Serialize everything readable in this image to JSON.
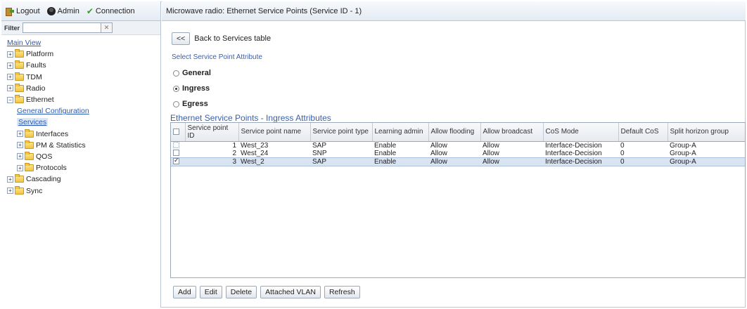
{
  "toolbar": {
    "logout": "Logout",
    "admin": "Admin",
    "connection": "Connection"
  },
  "filter": {
    "label": "Filter",
    "value": ""
  },
  "tree": {
    "main_view": "Main View",
    "platform": "Platform",
    "faults": "Faults",
    "tdm": "TDM",
    "radio": "Radio",
    "ethernet": "Ethernet",
    "general_configuration": "General Configuration",
    "services": "Services",
    "interfaces": "Interfaces",
    "pm_statistics": "PM & Statistics",
    "qos": "QOS",
    "protocols": "Protocols",
    "cascading": "Cascading",
    "sync": "Sync"
  },
  "main": {
    "title": "Microwave radio: Ethernet Service Points (Service ID - 1)",
    "back_button": "<<",
    "back_label": "Back to Services table",
    "select_attr_title": "Select Service Point Attribute",
    "radios": [
      {
        "label": "General",
        "checked": false
      },
      {
        "label": "Ingress",
        "checked": true
      },
      {
        "label": "Egress",
        "checked": false
      }
    ],
    "table_title": "Ethernet Service Points - Ingress Attributes",
    "columns": [
      "Service point ID",
      "Service point name",
      "Service point type",
      "Learning admin",
      "Allow flooding",
      "Allow broadcast",
      "CoS Mode",
      "Default CoS",
      "Split horizon group"
    ],
    "rows": [
      {
        "id": "1",
        "name": "West_23",
        "type": "SAP",
        "learning": "Enable",
        "flooding": "Allow",
        "broadcast": "Allow",
        "cos_mode": "Interface-Decision",
        "default_cos": "0",
        "split": "Group-A"
      },
      {
        "id": "2",
        "name": "West_24",
        "type": "SNP",
        "learning": "Enable",
        "flooding": "Allow",
        "broadcast": "Allow",
        "cos_mode": "Interface-Decision",
        "default_cos": "0",
        "split": "Group-A"
      },
      {
        "id": "3",
        "name": "West_2",
        "type": "SAP",
        "learning": "Enable",
        "flooding": "Allow",
        "broadcast": "Allow",
        "cos_mode": "Interface-Decision",
        "default_cos": "0",
        "split": "Group-A"
      }
    ],
    "buttons": {
      "add": "Add",
      "edit": "Edit",
      "delete": "Delete",
      "attached_vlan": "Attached VLAN",
      "refresh": "Refresh"
    }
  }
}
